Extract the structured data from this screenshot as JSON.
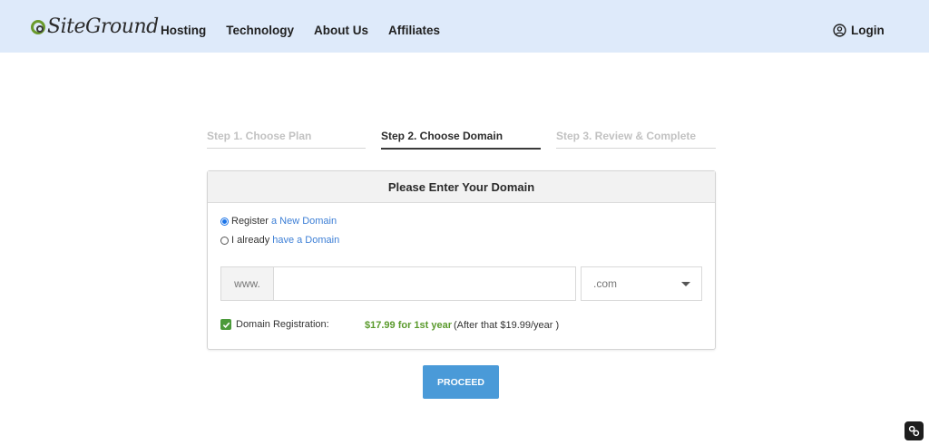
{
  "header": {
    "logo_text": "SiteGround",
    "nav": [
      "Hosting",
      "Technology",
      "About Us",
      "Affiliates"
    ],
    "login_label": "Login",
    "bg_color": "#deeafa"
  },
  "steps": [
    {
      "label": "Step 1. Choose Plan",
      "state": "inactive"
    },
    {
      "label": "Step 2. Choose Domain",
      "state": "active"
    },
    {
      "label": "Step 3. Review & Complete",
      "state": "inactive"
    }
  ],
  "panel": {
    "title": "Please Enter Your Domain",
    "option_register": {
      "prefix": "Register",
      "link": "a New Domain",
      "selected": true
    },
    "option_existing": {
      "prefix": "I already",
      "link": "have a Domain",
      "selected": false
    },
    "www_label": "www.",
    "domain_value": "",
    "tld_selected": ".com",
    "registration_label": "Domain Registration:",
    "registration_checked": true,
    "price_text": "$17.99 for 1st year",
    "after_text": "(After that $19.99/year )"
  },
  "proceed_label": "PROCEED",
  "colors": {
    "accent": "#4a9ad8",
    "price": "#5a9a2c",
    "link": "#3d7fd6"
  }
}
